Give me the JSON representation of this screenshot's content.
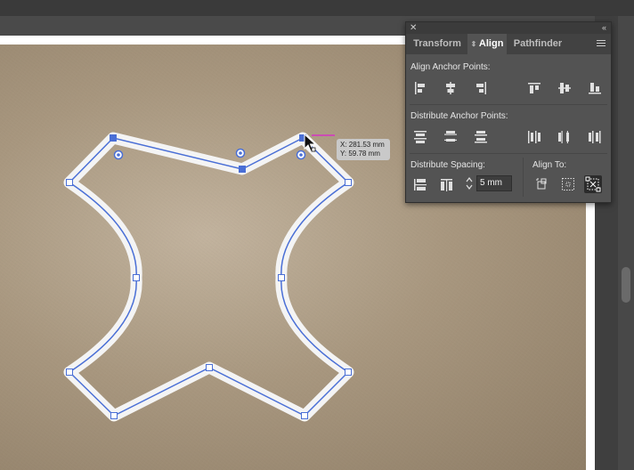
{
  "panel": {
    "tabs": [
      {
        "label": "Transform",
        "active": false
      },
      {
        "label": "Align",
        "active": true
      },
      {
        "label": "Pathfinder",
        "active": false
      }
    ],
    "sections": {
      "align_anchor_points": "Align Anchor Points:",
      "distribute_anchor_points": "Distribute Anchor Points:",
      "distribute_spacing": "Distribute Spacing:",
      "align_to": "Align To:"
    },
    "spacing_value": "5 mm",
    "align_anchor_buttons": [
      "align-left-icon",
      "align-horizontal-center-icon",
      "align-right-icon",
      "align-top-icon",
      "align-vertical-center-icon",
      "align-bottom-icon"
    ],
    "distribute_anchor_buttons": [
      "distribute-top-icon",
      "distribute-vertical-center-icon",
      "distribute-bottom-icon",
      "distribute-left-icon",
      "distribute-horizontal-center-icon",
      "distribute-right-icon"
    ],
    "align_to_buttons": [
      "align-to-selection-icon",
      "align-to-key-object-icon",
      "align-to-artboard-icon"
    ]
  },
  "tooltip": {
    "x": "X: 281.53 mm",
    "y": "Y: 59.78 mm"
  },
  "colors": {
    "selection": "#4a6fd6",
    "panel_bg": "#535353",
    "accent_magenta": "#d633c4"
  }
}
